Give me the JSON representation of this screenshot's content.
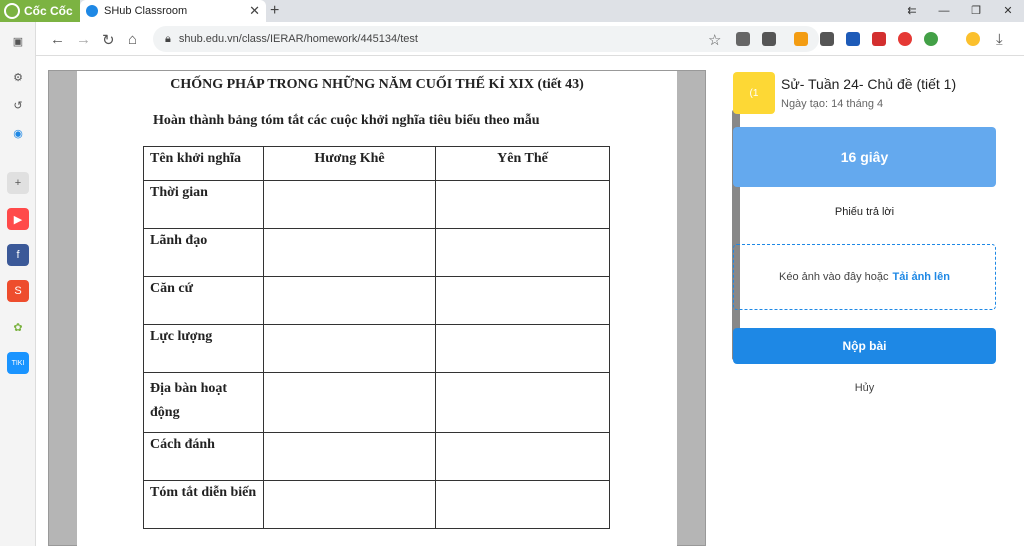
{
  "browser": {
    "brand": "Cốc Cốc",
    "tab_title": "SHub Classroom",
    "url": "shub.edu.vn/class/IERAR/homework/445134/test"
  },
  "document": {
    "title": "CHỐNG PHÁP TRONG NHỮNG NĂM CUỐI THẾ KỈ XIX (tiết 43)",
    "instruction": "Hoàn thành bảng tóm tắt các cuộc khởi nghĩa tiêu biểu theo mẫu",
    "table": {
      "headers": [
        "Tên khởi nghĩa",
        "Hương Khê",
        "Yên Thế"
      ],
      "rows": [
        "Thời gian",
        "Lãnh đạo",
        "Căn cứ",
        "Lực lượng",
        "Địa bàn hoạt động",
        "Cách đánh",
        "Tóm tắt diễn biến"
      ]
    }
  },
  "assignment": {
    "thumb_text": "(1",
    "title": "Sử- Tuần 24- Chủ đề (tiết 1)",
    "date": "Ngày tạo: 14 tháng 4",
    "timer": "16 giây",
    "answer_sheet": "Phiếu trả lời",
    "drop_text": "Kéo ảnh vào đây hoặc",
    "upload_link": "Tải ảnh lên",
    "submit": "Nộp bài",
    "cancel": "Hủy"
  },
  "colors": {
    "accent": "#1e88e5",
    "timer": "#64a9ee",
    "thumb": "#fdd835",
    "brand": "#7cb342"
  }
}
